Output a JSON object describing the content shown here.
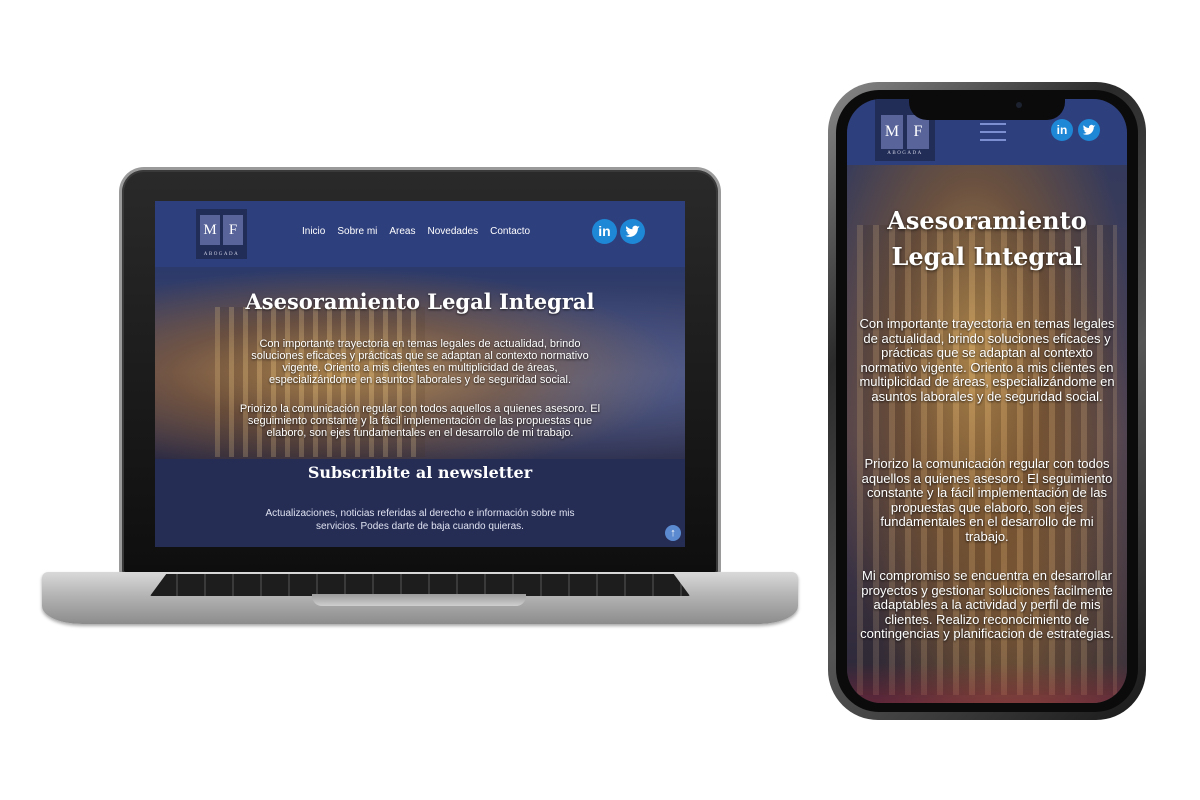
{
  "site": {
    "logo_letters": [
      "M",
      "F"
    ],
    "logo_subtitle": "ABOGADA",
    "nav": [
      "Inicio",
      "Sobre mi",
      "Areas",
      "Novedades",
      "Contacto"
    ],
    "social": {
      "linkedin_label": "in",
      "twitter_icon": "twitter-bird-icon"
    },
    "hero_title": "Asesoramiento Legal Integral",
    "paragraphs": [
      "Con importante trayectoria en temas legales de actualidad, brindo soluciones eficaces y prácticas que se adaptan al contexto normativo vigente. Oriento a mis clientes en multiplicidad de áreas, especializándome en asuntos laborales y de seguridad social.",
      "Priorizo la comunicación regular con todos aquellos a quienes asesoro. El seguimiento constante y la fácil implementación de las propuestas que elaboro, son ejes fundamentales en el desarrollo de mi trabajo.",
      "Mi compromiso se encuentra en desarrollar proyectos y gestionar soluciones facilmente adaptables a la actividad y perfil de mis clientes. Realizo reconocimiento de contingencias y planificacion de estrategias."
    ],
    "newsletter_title": "Subscribite al newsletter",
    "newsletter_text": "Actualizaciones, noticias referidas al derecho e información sobre mis servicios. Podes darte de baja cuando quieras.",
    "scroll_up_icon": "↑",
    "colors": {
      "nav": "#2e3f7d",
      "logo_bg": "#222d57",
      "newsletter_bg": "#252d55",
      "social": "#1e87d6"
    }
  }
}
